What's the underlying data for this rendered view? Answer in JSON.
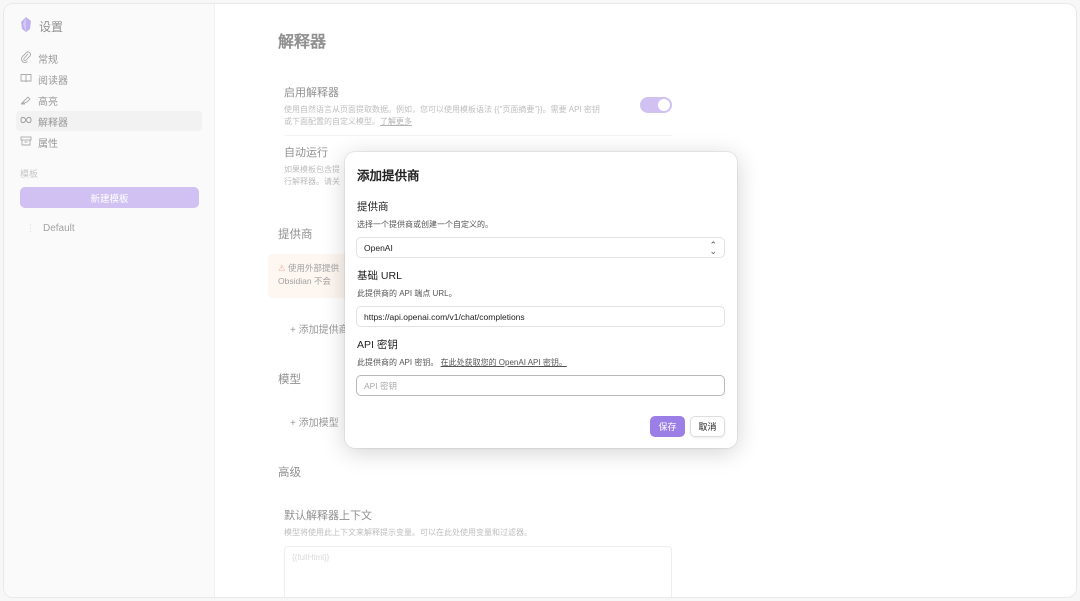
{
  "sidebar": {
    "title": "设置",
    "items": [
      {
        "label": "常规",
        "icon": "paperclip-icon"
      },
      {
        "label": "阅读器",
        "icon": "book-icon"
      },
      {
        "label": "高亮",
        "icon": "highlighter-icon"
      },
      {
        "label": "解释器",
        "icon": "infinity-icon"
      },
      {
        "label": "属性",
        "icon": "archive-icon"
      }
    ],
    "section_label": "模板",
    "new_template": "新建模板",
    "templates": [
      "Default"
    ]
  },
  "main": {
    "title": "解释器",
    "enable": {
      "name": "启用解释器",
      "desc_line1": "使用自然语言从页面提取数据。例如，您可以使用模板语法 {{\"页面摘要\"}}。需要 API 密钥",
      "desc_line2": "或下面配置的自定义模型。",
      "learn_more": "了解更多"
    },
    "auto_run": {
      "name": "自动运行",
      "desc_line1": "如果模板包含提",
      "desc_line2": "行解释器。请关"
    },
    "providers_title": "提供商",
    "warning_line1": "使用外部提供",
    "warning_line2": "Obsidian 不会",
    "add_provider": "+ 添加提供商",
    "models_title": "模型",
    "add_model": "+ 添加模型",
    "advanced_title": "高级",
    "context": {
      "name": "默认解释器上下文",
      "desc": "模型将使用此上下文来解释提示变量。可以在此处使用变量和过滤器。",
      "value": "{{fullHtml}}"
    }
  },
  "modal": {
    "title": "添加提供商",
    "provider_label": "提供商",
    "provider_desc": "选择一个提供商或创建一个自定义的。",
    "provider_value": "OpenAI",
    "url_label": "基础 URL",
    "url_desc": "此提供商的 API 端点 URL。",
    "url_value": "https://api.openai.com/v1/chat/completions",
    "key_label": "API 密钥",
    "key_desc": "此提供商的 API 密钥。",
    "key_link": "在此处获取您的 OpenAI API 密钥。",
    "key_placeholder": "API 密钥",
    "save": "保存",
    "cancel": "取消"
  },
  "colors": {
    "accent": "#a98ee8",
    "save_button": "#9b7ee6"
  }
}
